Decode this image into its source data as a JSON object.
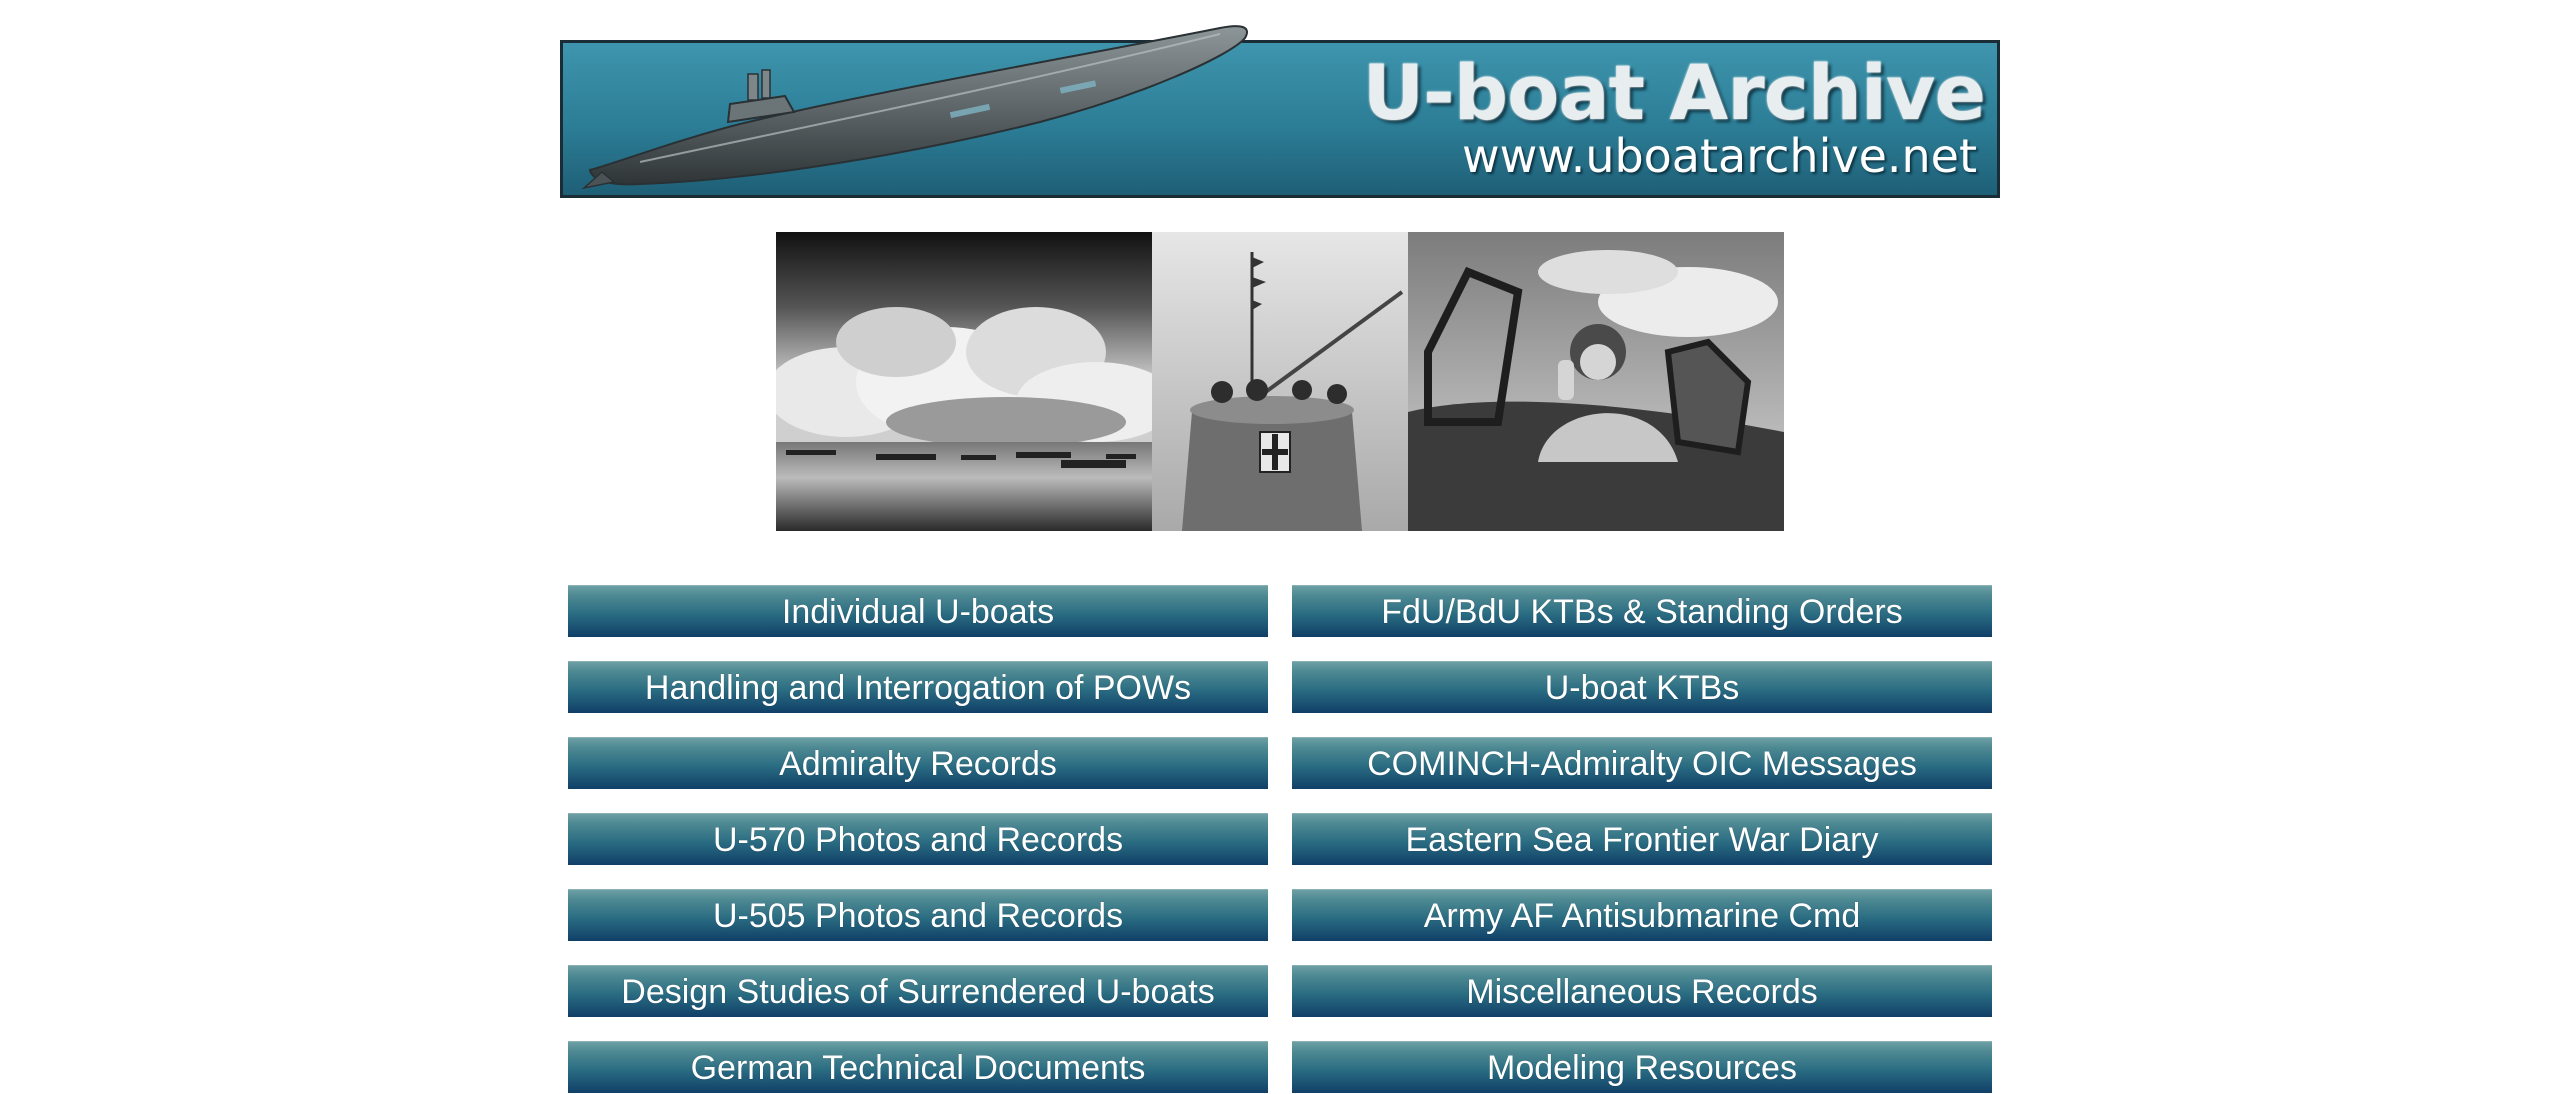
{
  "banner": {
    "title": "U-boat Archive",
    "url": "www.uboatarchive.net"
  },
  "photos": [
    {
      "icon": "convoy-at-sea-photo"
    },
    {
      "icon": "uboat-conning-tower-photo"
    },
    {
      "icon": "pilot-in-cockpit-photo"
    }
  ],
  "nav": {
    "left": [
      "Individual U-boats",
      "Handling and Interrogation of POWs",
      "Admiralty Records",
      "U-570 Photos and Records",
      "U-505 Photos and Records",
      "Design Studies of Surrendered U-boats",
      "German Technical Documents"
    ],
    "right": [
      "FdU/BdU KTBs & Standing Orders",
      "U-boat KTBs",
      "COMINCH-Admiralty OIC Messages",
      "Eastern Sea Frontier War Diary",
      "Army AF Antisubmarine Cmd",
      "Miscellaneous Records",
      "Modeling Resources"
    ]
  },
  "colors": {
    "banner_blue": "#2c7d96",
    "button_top": "#6c9fa4",
    "button_bottom": "#103f68"
  }
}
